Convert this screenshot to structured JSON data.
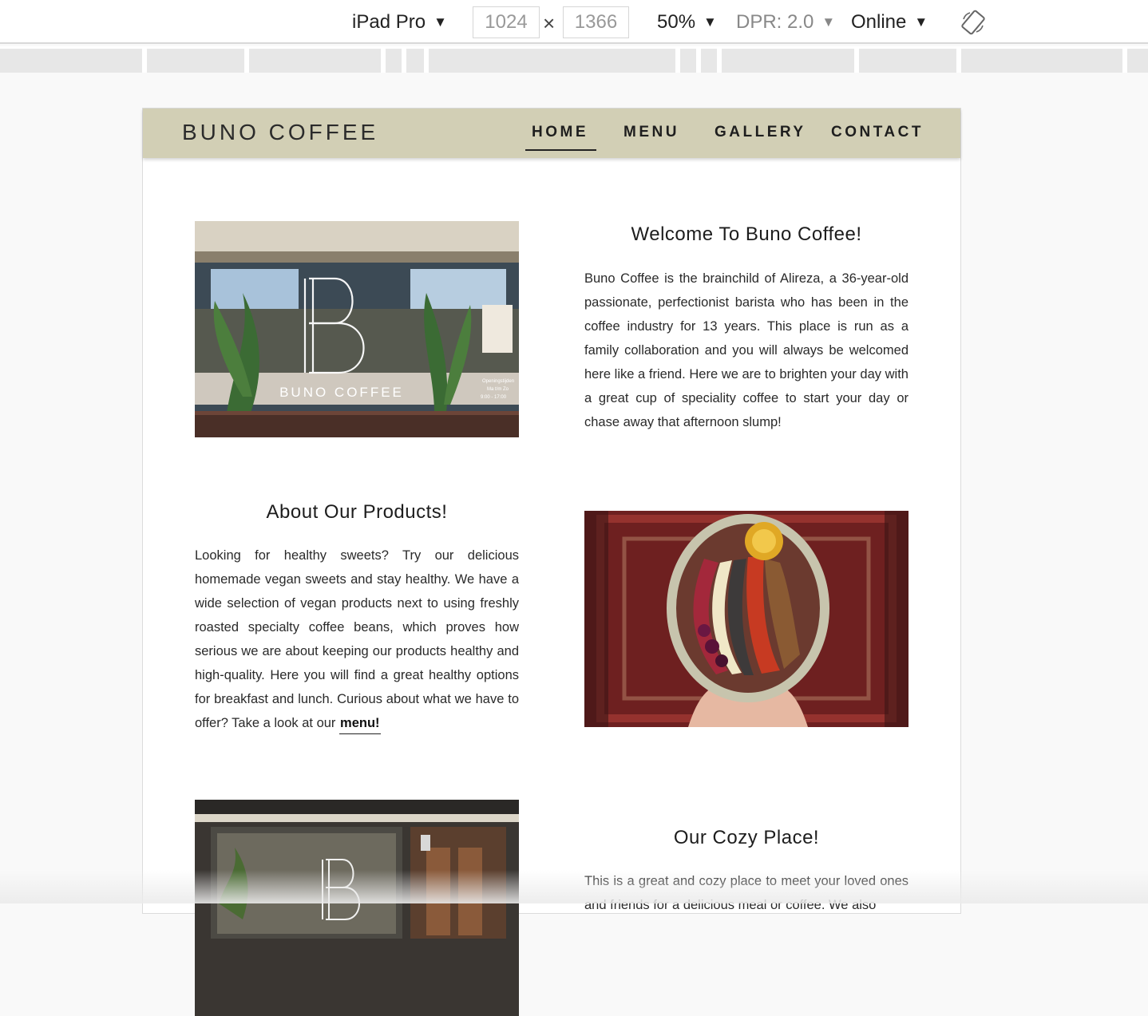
{
  "toolbar": {
    "device_name": "iPad Pro",
    "width_value": "1024",
    "height_value": "1366",
    "times_symbol": "×",
    "zoom": "50%",
    "dpr": "DPR: 2.0",
    "throttling": "Online",
    "caret": "▼"
  },
  "site": {
    "brand": "BUNO COFFEE",
    "nav": [
      "HOME",
      "MENU",
      "GALLERY",
      "CONTACT"
    ],
    "sections": [
      {
        "heading": "Welcome To Buno Coffee!",
        "text": "Buno Coffee is the brainchild of Alireza, a 36-year-old passionate, perfectionist barista who has been in the coffee industry for 13 years. This place is run as a family collaboration and you will always be welcomed here like a friend. Here we are to brighten your day with a great cup of speciality coffee to start your day or chase away that afternoon slump!"
      },
      {
        "heading": "About Our Products!",
        "text": "Looking for healthy sweets? Try our delicious homemade vegan sweets and stay healthy. We have a wide selection of vegan products next to using freshly roasted specialty coffee beans, which proves how serious we are about keeping our products healthy and high-quality. Here you will find a great healthy options for breakfast and lunch. Curious about what we have to offer? Take a look at our",
        "link": "menu!"
      },
      {
        "heading": "Our Cozy Place!",
        "text": "This is a great and cozy place to meet your loved ones and friends for a delicious meal or coffee. We also"
      }
    ],
    "storefront_sign": "BUNO COFFEE",
    "shop_hours_lines": [
      "Openingstijden",
      "Ma t/m Zo",
      "9:00 - 17:00"
    ]
  },
  "colors": {
    "nav_background": "#d2cfb5",
    "page_background": "#f9f9f9"
  }
}
